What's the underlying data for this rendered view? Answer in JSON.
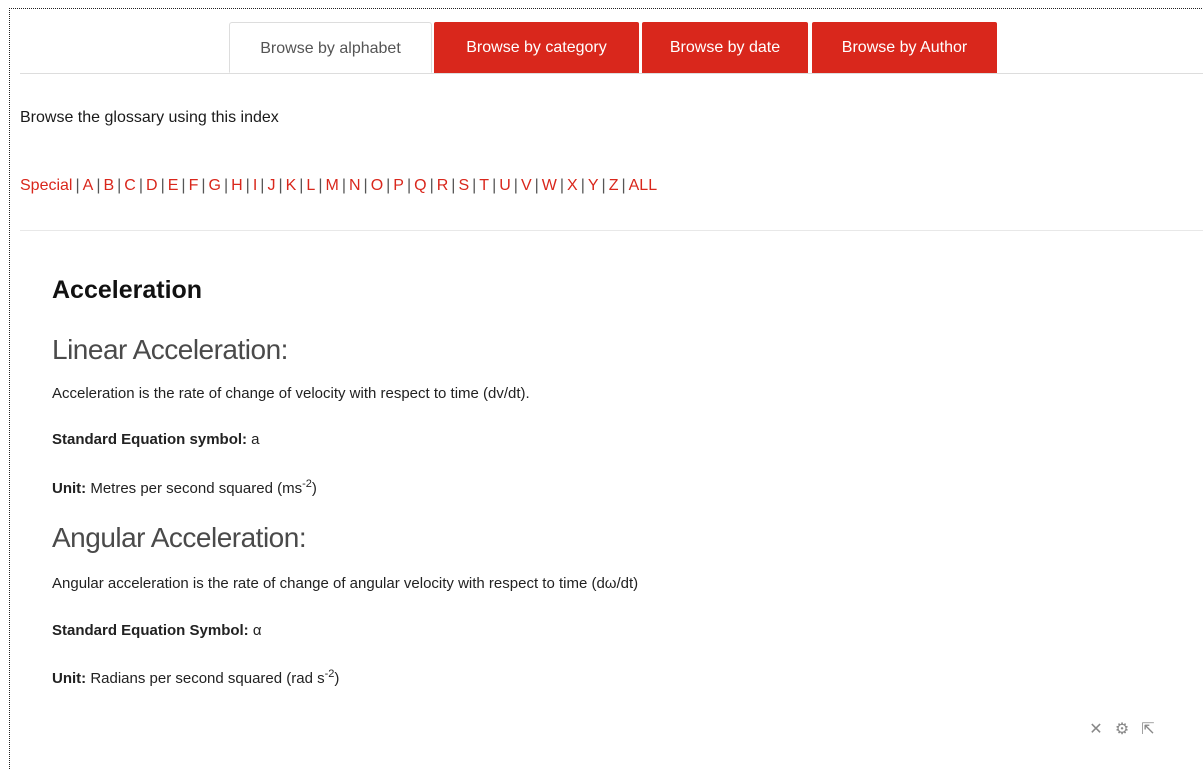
{
  "tabs": [
    {
      "label": "Browse by alphabet",
      "active": true
    },
    {
      "label": "Browse by category",
      "active": false
    },
    {
      "label": "Browse by date",
      "active": false
    },
    {
      "label": "Browse by Author",
      "active": false
    }
  ],
  "intro_text": "Browse the glossary using this index",
  "index_letters": [
    "Special",
    "A",
    "B",
    "C",
    "D",
    "E",
    "F",
    "G",
    "H",
    "I",
    "J",
    "K",
    "L",
    "M",
    "N",
    "O",
    "P",
    "Q",
    "R",
    "S",
    "T",
    "U",
    "V",
    "W",
    "X",
    "Y",
    "Z",
    "ALL"
  ],
  "entry": {
    "concept": "Acceleration",
    "linear_heading": "Linear Acceleration:",
    "linear_desc": "Acceleration is the rate of change of velocity with respect to time (dv/dt).",
    "linear_symbol_label": "Standard Equation symbol:",
    "linear_symbol_value": " a",
    "linear_unit_label": "Unit:",
    "linear_unit_value": " Metres per second squared (ms",
    "linear_unit_exp": "-2",
    "linear_unit_close": ")",
    "angular_heading": "Angular Acceleration:",
    "angular_desc": "Angular acceleration is the rate of change of angular velocity with respect to time (dω/dt)",
    "angular_symbol_label": "Standard Equation Symbol:",
    "angular_symbol_value": " α",
    "angular_unit_label": "Unit:",
    "angular_unit_value": " Radians per second squared (rad s",
    "angular_unit_exp": "-2",
    "angular_unit_close": ")"
  },
  "action_icons": [
    "delete-icon",
    "settings-icon",
    "export-icon"
  ],
  "colors": {
    "accent": "#d9271c"
  }
}
